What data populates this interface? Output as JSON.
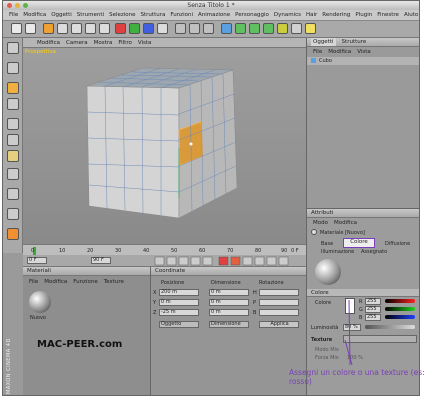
{
  "window": {
    "title": "Senza Titolo 1 *"
  },
  "menubar": [
    "File",
    "Modifica",
    "Oggetti",
    "Strumenti",
    "Selezione",
    "Struttura",
    "Funzioni",
    "Animazione",
    "Personaggio",
    "Dynamics",
    "Hair",
    "Rendering",
    "Plugin",
    "Finestre",
    "Aiuto"
  ],
  "viewport": {
    "menu": [
      "Modifica",
      "Camera",
      "Mostra",
      "Filtro",
      "Vista"
    ],
    "label": "Prospettiva"
  },
  "timeline": {
    "ticks": [
      "0",
      "10",
      "20",
      "30",
      "40",
      "50",
      "60",
      "70",
      "80",
      "90"
    ],
    "frame_label": "0 F"
  },
  "transport": {
    "start": "0 F",
    "end": "90 F"
  },
  "materials": {
    "title": "Materiali",
    "menu": [
      "File",
      "Modifica",
      "Funzione",
      "Texture"
    ],
    "item_label": "Nuovo"
  },
  "coordinates": {
    "title": "Coordinate",
    "headers": [
      "Posizione",
      "Dimensione",
      "Rotazione"
    ],
    "rows": [
      {
        "axis": "X",
        "pos": "200 m",
        "dim": "0 m",
        "rot": "H"
      },
      {
        "axis": "Y",
        "pos": "0 m",
        "dim": "0 m",
        "rot": "P"
      },
      {
        "axis": "Z",
        "pos": "-25 m",
        "dim": "0 m",
        "rot": "B"
      }
    ],
    "mode_select": "Oggetto",
    "dim_select": "Dimensione",
    "apply_button": "Applica"
  },
  "objects": {
    "tabs": [
      "Oggetti",
      "Strutture"
    ],
    "menu": [
      "File",
      "Modifica",
      "Vista"
    ],
    "item": "Cubo"
  },
  "attributes": {
    "title": "Attributi",
    "menu": [
      "Modo",
      "Modifica"
    ],
    "material_name": "Materiale [Nuovo]",
    "tabs": [
      "Base",
      "Colore",
      "Diffusione"
    ],
    "tab_row2": "Illuminazione",
    "tab_row2b": "Assegnato",
    "section": "Colore",
    "color_label": "Colore",
    "rgb": [
      {
        "ch": "R",
        "val": "255"
      },
      {
        "ch": "G",
        "val": "255"
      },
      {
        "ch": "B",
        "val": "255"
      }
    ],
    "lum_label": "Luminosità",
    "lum_val": "80 %",
    "texture_label": "Texture",
    "mix_mode": "Modo Mix",
    "mix_strength": "Forza Mix",
    "mix_val": "100 %"
  },
  "watermark": "MAC-PEER.com",
  "side_brand": "MAXON CINEMA 4D",
  "annotation": "Assegni un colore o una texture (es: rosso)",
  "colors": {
    "purple": "#7a3fb8",
    "highlight_orange": "#e08a1e",
    "selected_face": "#d89a3a"
  }
}
